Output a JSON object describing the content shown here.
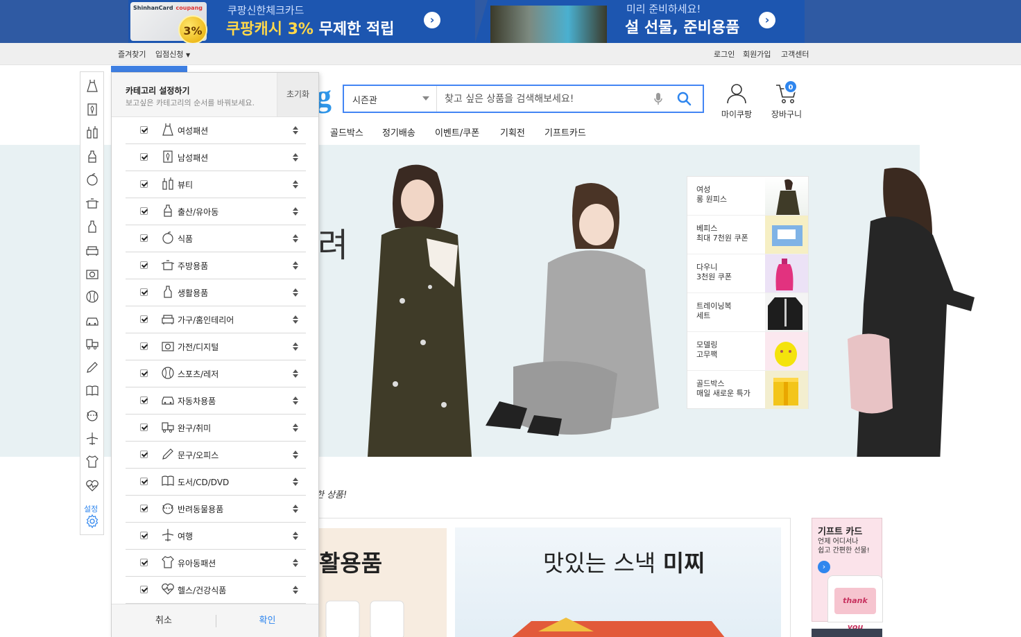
{
  "banner": {
    "left_card_brand": "ShinhanCard",
    "left_card_logo": "coupang",
    "left_coin": "3%",
    "left_line1": "쿠팡신한체크카드",
    "left_line2_a": "쿠팡캐시 3%",
    "left_line2_b": " 무제한 적립",
    "right_line1": "미리 준비하세요!",
    "right_line2": "설 선물, 준비용품",
    "arrow_icon": "chevron-right-icon"
  },
  "utility": {
    "left": [
      "즐겨찾기",
      "입점신청"
    ],
    "right": [
      "로그인",
      "회원가입",
      "고객센터"
    ]
  },
  "header": {
    "logo_partial": "g",
    "search_category": "시즌관",
    "search_placeholder": "찾고 싶은 상품을 검색해보세요!",
    "mycoupang_label": "마이쿠팡",
    "cart_label": "장바구니",
    "cart_count": "0",
    "accent_color": "#4285f4"
  },
  "gnb": [
    "골드박스",
    "정기배송",
    "이벤트/쿠폰",
    "기획전",
    "기프트카드"
  ],
  "hero": {
    "partial_text": "려",
    "promos": [
      {
        "line1": "여성",
        "line2": "롱 원피스"
      },
      {
        "line1": "베피스",
        "line2": "최대 7천원 쿠폰"
      },
      {
        "line1": "다우니",
        "line2": "3천원 쿠폰"
      },
      {
        "line1": "트레이닝복",
        "line2": "세트"
      },
      {
        "line1": "모델링",
        "line2": "고무팩"
      },
      {
        "line1": "골드박스",
        "line2": "매일 새로운 특가"
      }
    ]
  },
  "below": {
    "subtitle_partial": "한 상품!",
    "panel1_text": "활용품",
    "panel2_text_a": "맛있는 스낵 ",
    "panel2_text_b": "미찌",
    "gift_title": "기프트 카드",
    "gift_desc": "언제 어디서나\n쉽고 간편한 선물!",
    "gift_thankyou": "thank you"
  },
  "rail": {
    "setting_label": "설정"
  },
  "settings_panel": {
    "title": "카테고리 설정하기",
    "description": "보고싶은 카테고리의 순서를 바꿔보세요.",
    "reset_label": "초기화",
    "cancel_label": "취소",
    "confirm_label": "확인",
    "categories": [
      {
        "label": "여성패션",
        "icon": "dress-icon",
        "checked": true
      },
      {
        "label": "남성패션",
        "icon": "shirt-tie-icon",
        "checked": true
      },
      {
        "label": "뷰티",
        "icon": "cosmetics-icon",
        "checked": true
      },
      {
        "label": "출산/유아동",
        "icon": "baby-bottle-icon",
        "checked": true
      },
      {
        "label": "식품",
        "icon": "apple-icon",
        "checked": true
      },
      {
        "label": "주방용품",
        "icon": "pot-icon",
        "checked": true
      },
      {
        "label": "생활용품",
        "icon": "detergent-bottle-icon",
        "checked": true
      },
      {
        "label": "가구/홈인테리어",
        "icon": "sofa-icon",
        "checked": true
      },
      {
        "label": "가전/디지털",
        "icon": "camera-icon",
        "checked": true
      },
      {
        "label": "스포츠/레저",
        "icon": "baseball-icon",
        "checked": true
      },
      {
        "label": "자동차용품",
        "icon": "car-icon",
        "checked": true
      },
      {
        "label": "완구/취미",
        "icon": "toy-truck-icon",
        "checked": true
      },
      {
        "label": "문구/오피스",
        "icon": "pencil-icon",
        "checked": true
      },
      {
        "label": "도서/CD/DVD",
        "icon": "book-icon",
        "checked": true
      },
      {
        "label": "반려동물용품",
        "icon": "dog-icon",
        "checked": true
      },
      {
        "label": "여행",
        "icon": "airplane-icon",
        "checked": true
      },
      {
        "label": "유아동패션",
        "icon": "baby-clothes-icon",
        "checked": true
      },
      {
        "label": "헬스/건강식품",
        "icon": "heartbeat-icon",
        "checked": true
      }
    ]
  }
}
